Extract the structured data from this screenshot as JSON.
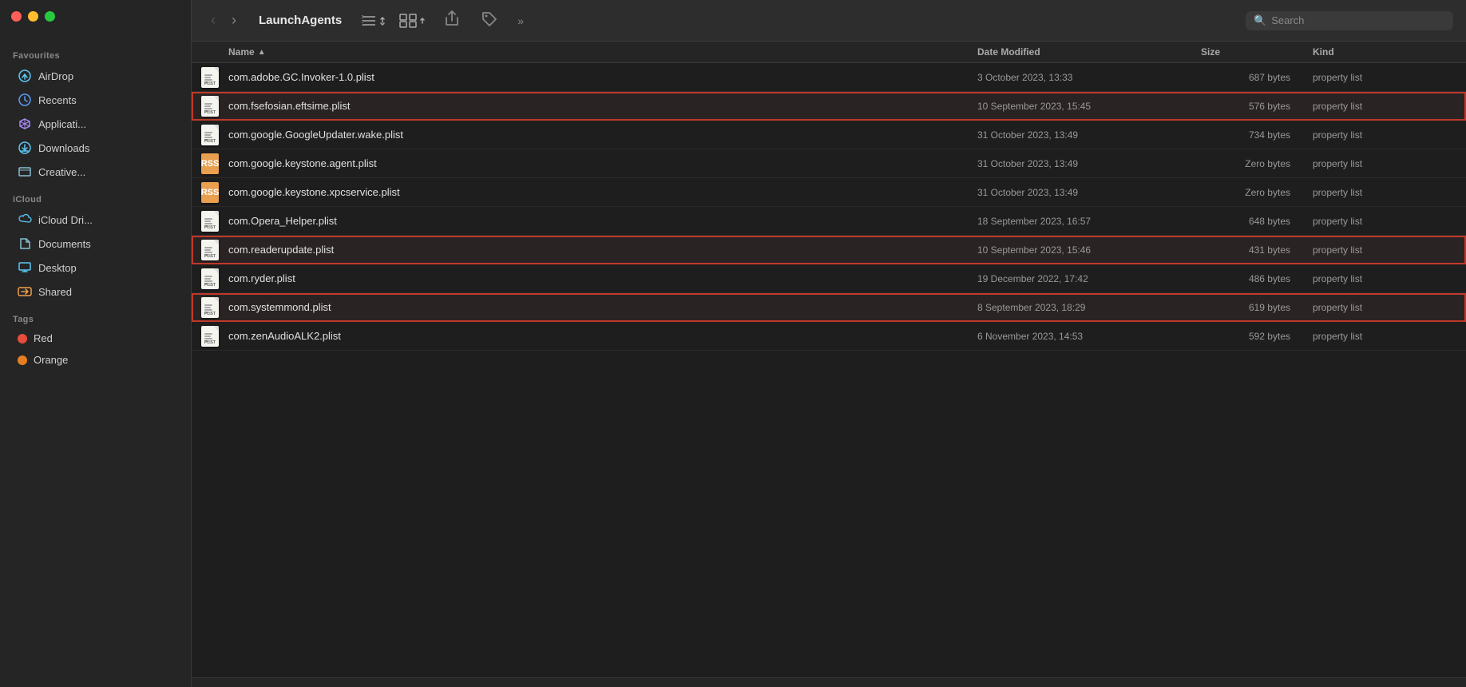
{
  "window": {
    "title": "LaunchAgents",
    "controls": {
      "close": "close",
      "minimize": "minimize",
      "maximize": "maximize"
    }
  },
  "toolbar": {
    "back_label": "‹",
    "forward_label": "›",
    "title": "LaunchAgents",
    "list_view_label": "☰",
    "grid_view_label": "⊞",
    "share_label": "↑",
    "tag_label": "🏷",
    "more_label": "»",
    "search_placeholder": "Search"
  },
  "columns": {
    "name": "Name",
    "date_modified": "Date Modified",
    "size": "Size",
    "kind": "Kind"
  },
  "sidebar": {
    "favourites_label": "Favourites",
    "icloud_label": "iCloud",
    "tags_label": "Tags",
    "items_favourites": [
      {
        "id": "airdrop",
        "label": "AirDrop",
        "icon": "airdrop"
      },
      {
        "id": "recents",
        "label": "Recents",
        "icon": "recents"
      },
      {
        "id": "applications",
        "label": "Applicati...",
        "icon": "applications"
      },
      {
        "id": "downloads",
        "label": "Downloads",
        "icon": "downloads"
      },
      {
        "id": "creative",
        "label": "Creative...",
        "icon": "creative"
      }
    ],
    "items_icloud": [
      {
        "id": "icloud-drive",
        "label": "iCloud Dri...",
        "icon": "icloud"
      },
      {
        "id": "documents",
        "label": "Documents",
        "icon": "documents"
      },
      {
        "id": "desktop",
        "label": "Desktop",
        "icon": "desktop"
      },
      {
        "id": "shared",
        "label": "Shared",
        "icon": "shared"
      }
    ],
    "items_tags": [
      {
        "id": "red",
        "label": "Red",
        "color": "#e74c3c"
      },
      {
        "id": "orange",
        "label": "Orange",
        "color": "#e67e22"
      }
    ]
  },
  "files": [
    {
      "name": "com.adobe.GC.Invoker-1.0.plist",
      "date": "3 October 2023, 13:33",
      "size": "687 bytes",
      "kind": "property list",
      "icon_type": "plist",
      "highlighted": false
    },
    {
      "name": "com.fsefosian.eftsime.plist",
      "date": "10 September 2023, 15:45",
      "size": "576 bytes",
      "kind": "property list",
      "icon_type": "plist",
      "highlighted": true
    },
    {
      "name": "com.google.GoogleUpdater.wake.plist",
      "date": "31 October 2023, 13:49",
      "size": "734 bytes",
      "kind": "property list",
      "icon_type": "plist",
      "highlighted": false
    },
    {
      "name": "com.google.keystone.agent.plist",
      "date": "31 October 2023, 13:49",
      "size": "Zero bytes",
      "kind": "property list",
      "icon_type": "rss",
      "highlighted": false
    },
    {
      "name": "com.google.keystone.xpcservice.plist",
      "date": "31 October 2023, 13:49",
      "size": "Zero bytes",
      "kind": "property list",
      "icon_type": "rss",
      "highlighted": false
    },
    {
      "name": "com.Opera_Helper.plist",
      "date": "18 September 2023, 16:57",
      "size": "648 bytes",
      "kind": "property list",
      "icon_type": "plist",
      "highlighted": false
    },
    {
      "name": "com.readerupdate.plist",
      "date": "10 September 2023, 15:46",
      "size": "431 bytes",
      "kind": "property list",
      "icon_type": "plist",
      "highlighted": true
    },
    {
      "name": "com.ryder.plist",
      "date": "19 December 2022, 17:42",
      "size": "486 bytes",
      "kind": "property list",
      "icon_type": "plist",
      "highlighted": false
    },
    {
      "name": "com.systemmond.plist",
      "date": "8 September 2023, 18:29",
      "size": "619 bytes",
      "kind": "property list",
      "icon_type": "plist",
      "highlighted": true
    },
    {
      "name": "com.zenAudioALK2.plist",
      "date": "6 November 2023, 14:53",
      "size": "592 bytes",
      "kind": "property list",
      "icon_type": "plist",
      "highlighted": false
    }
  ]
}
